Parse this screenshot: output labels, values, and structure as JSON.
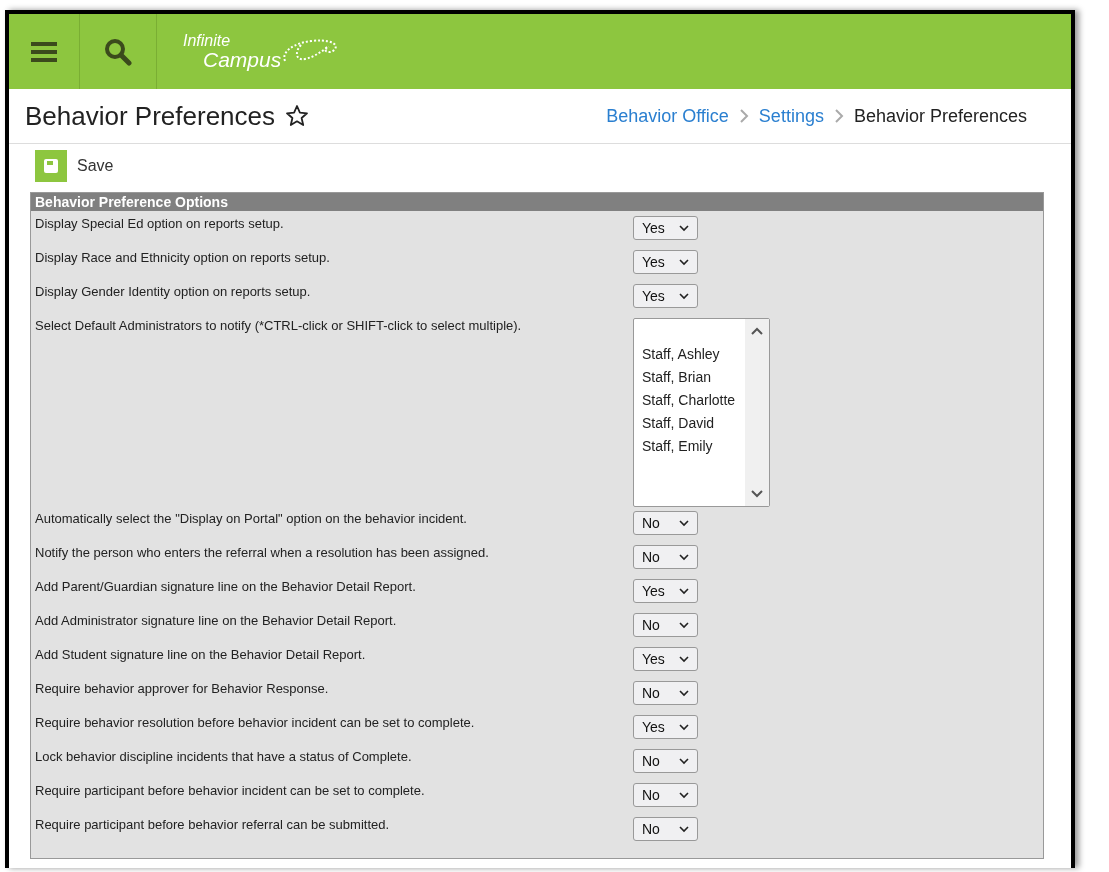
{
  "header": {
    "logo_line_1": "Infinite",
    "logo_line_2": "Campus"
  },
  "page": {
    "title": "Behavior Preferences",
    "favorite": false
  },
  "breadcrumbs": [
    {
      "label": "Behavior Office",
      "link": true
    },
    {
      "label": "Settings",
      "link": true
    },
    {
      "label": "Behavior Preferences",
      "link": false
    }
  ],
  "toolbar": {
    "save": "Save"
  },
  "panel": {
    "title": "Behavior Preference Options",
    "rows": [
      {
        "kind": "select",
        "label": "Display Special Ed option on reports setup.",
        "value": "Yes"
      },
      {
        "kind": "select",
        "label": "Display Race and Ethnicity option on reports setup.",
        "value": "Yes"
      },
      {
        "kind": "select",
        "label": "Display Gender Identity option on reports setup.",
        "value": "Yes"
      },
      {
        "kind": "listbox",
        "label": "Select Default Administrators to notify (*CTRL-click or SHIFT-click to select multiple).",
        "options": [
          {
            "label": "Staff, Ashley",
            "selected": false
          },
          {
            "label": "Staff, Brian",
            "selected": false
          },
          {
            "label": "Staff, Charlotte",
            "selected": false
          },
          {
            "label": "Staff, David",
            "selected": false
          },
          {
            "label": "Staff, Emily",
            "selected": false
          }
        ]
      },
      {
        "kind": "select",
        "label": "Automatically select the \"Display on Portal\" option on the behavior incident.",
        "value": "No"
      },
      {
        "kind": "select",
        "label": "Notify the person who enters the referral when a resolution has been assigned.",
        "value": "No"
      },
      {
        "kind": "select",
        "label": "Add Parent/Guardian signature line on the Behavior Detail Report.",
        "value": "Yes"
      },
      {
        "kind": "select",
        "label": "Add Administrator signature line on the Behavior Detail Report.",
        "value": "No"
      },
      {
        "kind": "select",
        "label": "Add Student signature line on the Behavior Detail Report.",
        "value": "Yes"
      },
      {
        "kind": "select",
        "label": "Require behavior approver for Behavior Response.",
        "value": "No"
      },
      {
        "kind": "select",
        "label": "Require behavior resolution before behavior incident can be set to complete.",
        "value": "Yes"
      },
      {
        "kind": "select",
        "label": "Lock behavior discipline incidents that have a status of Complete.",
        "value": "No"
      },
      {
        "kind": "select",
        "label": "Require participant before behavior incident can be set to complete.",
        "value": "No"
      },
      {
        "kind": "select",
        "label": "Require participant before behavior referral can be submitted.",
        "value": "No"
      }
    ]
  }
}
